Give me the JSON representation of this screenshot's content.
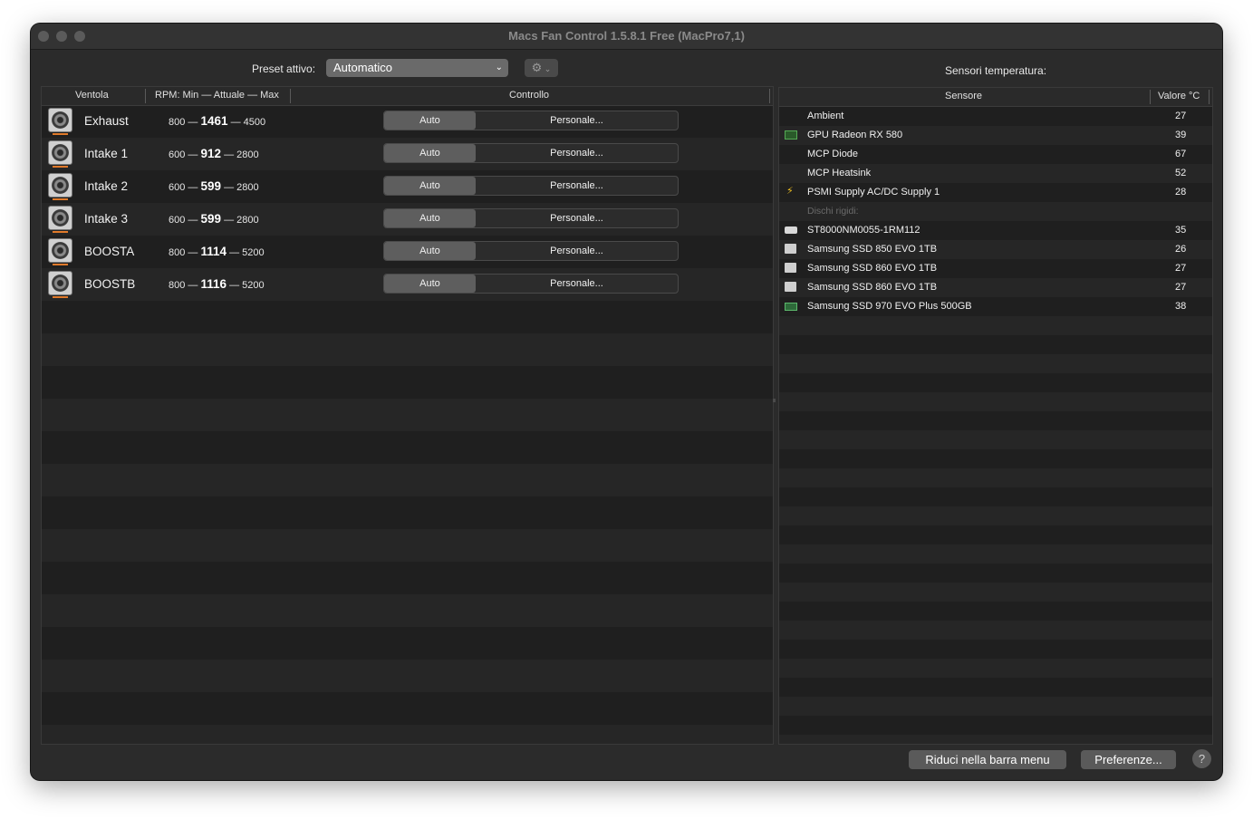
{
  "window": {
    "title": "Macs Fan Control 1.5.8.1 Free (MacPro7,1)"
  },
  "preset": {
    "label": "Preset attivo:",
    "selected": "Automatico",
    "settings_icon": "gear-icon"
  },
  "fans": {
    "columns": {
      "fan": "Ventola",
      "rpm": "RPM: Min — Attuale — Max",
      "control": "Controllo"
    },
    "separator": "—",
    "auto_label": "Auto",
    "custom_label": "Personale...",
    "rows": [
      {
        "name": "Exhaust",
        "min": "800",
        "current": "1461",
        "max": "4500"
      },
      {
        "name": "Intake 1",
        "min": "600",
        "current": "912",
        "max": "2800"
      },
      {
        "name": "Intake 2",
        "min": "600",
        "current": "599",
        "max": "2800"
      },
      {
        "name": "Intake 3",
        "min": "600",
        "current": "599",
        "max": "2800"
      },
      {
        "name": "BOOSTA",
        "min": "800",
        "current": "1114",
        "max": "5200"
      },
      {
        "name": "BOOSTB",
        "min": "800",
        "current": "1116",
        "max": "5200"
      }
    ]
  },
  "sensors": {
    "title": "Sensori temperatura:",
    "columns": {
      "sensor": "Sensore",
      "value": "Valore °C"
    },
    "rows": [
      {
        "name": "Ambient",
        "value": "27",
        "icon": ""
      },
      {
        "name": "GPU Radeon RX 580",
        "value": "39",
        "icon": "gpu-icon"
      },
      {
        "name": "MCP Diode",
        "value": "67",
        "icon": ""
      },
      {
        "name": "MCP Heatsink",
        "value": "52",
        "icon": ""
      },
      {
        "name": "PSMI Supply AC/DC Supply 1",
        "value": "28",
        "icon": "lightning-icon"
      },
      {
        "group": "Dischi rigidi:"
      },
      {
        "name": "ST8000NM0055-1RM112",
        "value": "35",
        "icon": "hdd-icon"
      },
      {
        "name": "Samsung SSD 850 EVO 1TB",
        "value": "26",
        "icon": "ssd-icon"
      },
      {
        "name": "Samsung SSD 860 EVO 1TB",
        "value": "27",
        "icon": "ssd-icon"
      },
      {
        "name": "Samsung SSD 860 EVO 1TB",
        "value": "27",
        "icon": "ssd-icon"
      },
      {
        "name": "Samsung SSD 970 EVO Plus 500GB",
        "value": "38",
        "icon": "nvme-icon"
      }
    ]
  },
  "footer": {
    "hide_button": "Riduci nella barra menu",
    "prefs_button": "Preferenze...",
    "help_button": "?"
  }
}
